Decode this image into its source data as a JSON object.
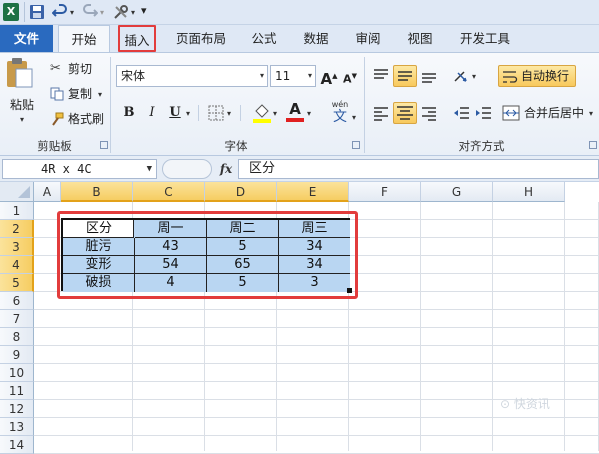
{
  "qat": {
    "excel_icon": "X",
    "save_icon": "save-icon",
    "undo_icon": "undo-icon",
    "redo_icon": "redo-icon",
    "tools_icon": "tools-icon",
    "more": "▾"
  },
  "tabs": {
    "file": "文件",
    "home": "开始",
    "insert": "插入",
    "page_layout": "页面布局",
    "formulas": "公式",
    "data": "数据",
    "review": "审阅",
    "view": "视图",
    "developer": "开发工具"
  },
  "ribbon": {
    "clipboard": {
      "paste": "粘贴",
      "cut": "剪切",
      "copy": "复制",
      "format_painter": "格式刷",
      "group": "剪贴板"
    },
    "font": {
      "name": "宋体",
      "size": "11",
      "bold": "B",
      "italic": "I",
      "underline": "U",
      "grow": "A",
      "shrink": "A",
      "font_color": "A",
      "wen": "wén",
      "wen_char": "文",
      "group": "字体"
    },
    "alignment": {
      "wrap": "自动换行",
      "merge": "合并后居中",
      "group": "对齐方式"
    }
  },
  "formula_bar": {
    "name_box": "4R x 4C",
    "fx": "fx",
    "value": "区分"
  },
  "grid": {
    "columns": [
      "A",
      "B",
      "C",
      "D",
      "E",
      "F",
      "G",
      "H"
    ],
    "rows": [
      "1",
      "2",
      "3",
      "4",
      "5",
      "6",
      "7",
      "8",
      "9",
      "10",
      "11",
      "12",
      "13",
      "14"
    ]
  },
  "table": {
    "header": [
      "区分",
      "周一",
      "周二",
      "周三"
    ],
    "rows": [
      [
        "脏污",
        "43",
        "5",
        "34"
      ],
      [
        "变形",
        "54",
        "65",
        "34"
      ],
      [
        "破损",
        "4",
        "5",
        "3"
      ]
    ]
  },
  "colors": {
    "accent": "#2a6abf",
    "selection": "#b9d6f2",
    "highlight": "#e23c3c"
  }
}
